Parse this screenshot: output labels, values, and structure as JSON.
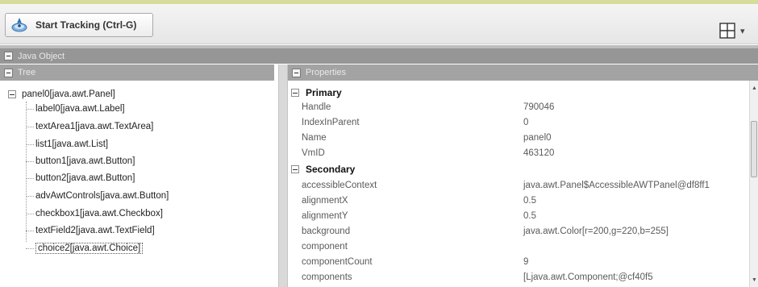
{
  "toolbar": {
    "start_label": "Start Tracking (Ctrl-G)",
    "start_icon": "tracking-icon",
    "layout_icon": "grid-layout-icon",
    "layout_arrow": "▾"
  },
  "panels": {
    "java_object": "Java Object",
    "tree": "Tree",
    "properties": "Properties"
  },
  "tree": {
    "root": "panel0[java.awt.Panel]",
    "children": [
      "label0[java.awt.Label]",
      "textArea1[java.awt.TextArea]",
      "list1[java.awt.List]",
      "button1[java.awt.Button]",
      "button2[java.awt.Button]",
      "advAwtControls[java.awt.Button]",
      "checkbox1[java.awt.Checkbox]",
      "textField2[java.awt.TextField]",
      "choice2[java.awt.Choice]"
    ],
    "selected_index": 8
  },
  "properties": {
    "primary": {
      "label": "Primary",
      "rows": [
        {
          "name": "Handle",
          "value": "790046"
        },
        {
          "name": "IndexInParent",
          "value": "0"
        },
        {
          "name": "Name",
          "value": "panel0"
        },
        {
          "name": "VmID",
          "value": "463120"
        }
      ]
    },
    "secondary": {
      "label": "Secondary",
      "rows": [
        {
          "name": "accessibleContext",
          "value": "java.awt.Panel$AccessibleAWTPanel@df8ff1"
        },
        {
          "name": "alignmentX",
          "value": "0.5"
        },
        {
          "name": "alignmentY",
          "value": "0.5"
        },
        {
          "name": "background",
          "value": "java.awt.Color[r=200,g=220,b=255]"
        },
        {
          "name": "component",
          "value": ""
        },
        {
          "name": "componentCount",
          "value": "9"
        },
        {
          "name": "components",
          "value": "[Ljava.awt.Component;@cf40f5"
        }
      ]
    }
  },
  "scrollbar": {
    "up": "▲",
    "down": "▼"
  },
  "colors": {
    "header_bg": "#a3a3a3",
    "accent_strip": "#d6dc9c"
  }
}
